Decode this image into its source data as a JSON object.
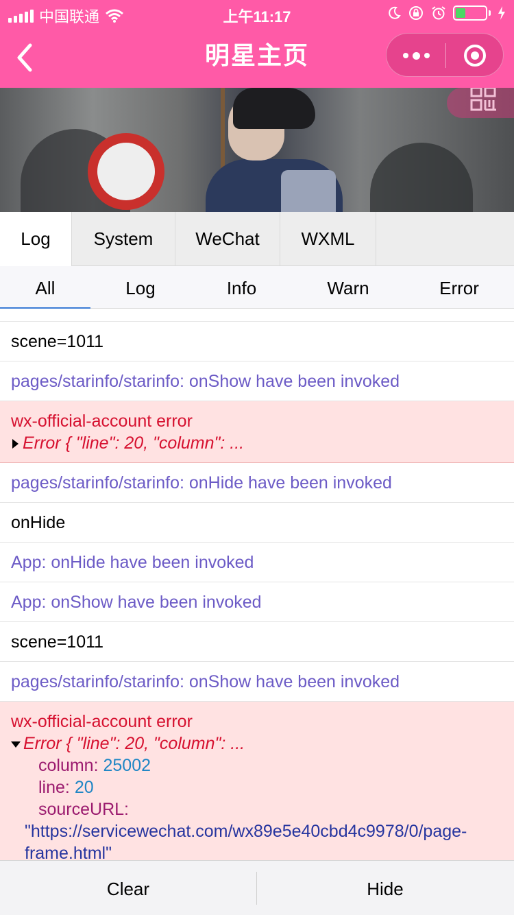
{
  "status_bar": {
    "carrier": "中国联通",
    "time": "上午11:17"
  },
  "nav": {
    "title": "明星主页"
  },
  "vconsole": {
    "tabs": [
      "Log",
      "System",
      "WeChat",
      "WXML"
    ],
    "active_tab": "Log",
    "filters": [
      "All",
      "Log",
      "Info",
      "Warn",
      "Error"
    ],
    "active_filter": "All"
  },
  "logs": {
    "row_scene_1": "scene=1011",
    "row_show_1": "pages/starinfo/starinfo: onShow have been invoked",
    "row_err_1_title": "wx-official-account error",
    "row_err_1_detail": "Error { \"line\": 20, \"column\": ...",
    "row_hide_1": "pages/starinfo/starinfo: onHide have been invoked",
    "row_onhide": "onHide",
    "row_app_hide": "App: onHide have been invoked",
    "row_app_show": "App: onShow have been invoked",
    "row_scene_2": "scene=1011",
    "row_show_2": "pages/starinfo/starinfo: onShow have been invoked",
    "row_err_2_title": "wx-official-account error",
    "row_err_2_detail": "Error { \"line\": 20, \"column\": ...",
    "row_err_2_column_key": "column:",
    "row_err_2_column_val": "25002",
    "row_err_2_line_key": "line:",
    "row_err_2_line_val": "20",
    "row_err_2_source_key": "sourceURL:",
    "row_err_2_source_val_1": "\"https://servicewechat.com/wx89e5e40cbd4c9978/0/page-",
    "row_err_2_source_val_2": "frame.html\""
  },
  "bottom_bar": {
    "clear_label": "Clear",
    "hide_label": "Hide"
  },
  "colors": {
    "brand_pink": "#ff5aa7",
    "info_purple": "#6c5bc6",
    "error_red": "#d6102f",
    "error_bg": "#ffe2e2"
  }
}
